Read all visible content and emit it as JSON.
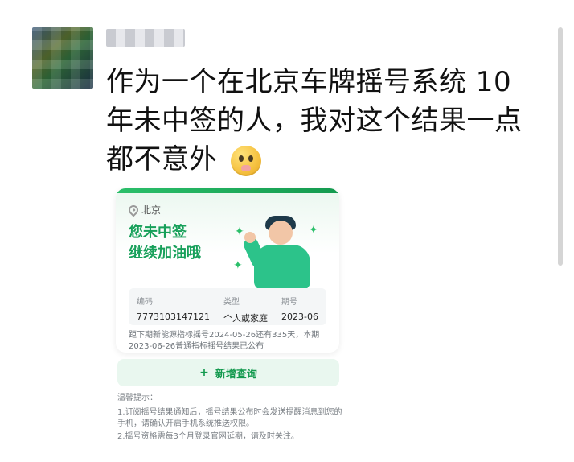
{
  "post": {
    "text": "作为一个在北京车牌摇号系统 10 年未中签的人，我对这个结果一点都不意外",
    "emoji_icon": "shushing-face-emoji"
  },
  "screenshot": {
    "location": "北京",
    "status_lines": [
      "您未中签",
      "继续加油哦"
    ],
    "fields": [
      {
        "label": "编码",
        "value": "7773103147121"
      },
      {
        "label": "类型",
        "value": "个人或家庭"
      },
      {
        "label": "期号",
        "value": "2023-06"
      }
    ],
    "note": "距下期新能源指标摇号2024-05-26还有335天，本期2023-06-26普通指标摇号结果已公布",
    "button_label": "新增查询",
    "tips": {
      "title": "温馨提示：",
      "items": [
        "1.订阅摇号结果通知后，摇号结果公布时会发送提醒消息到您的手机，请确认开启手机系统推送权限。",
        "2.摇号资格需每3个月登录官网延期，请及时关注。"
      ]
    }
  },
  "colors": {
    "accent_green": "#17a05a",
    "button_bg": "#e9f7ef"
  }
}
